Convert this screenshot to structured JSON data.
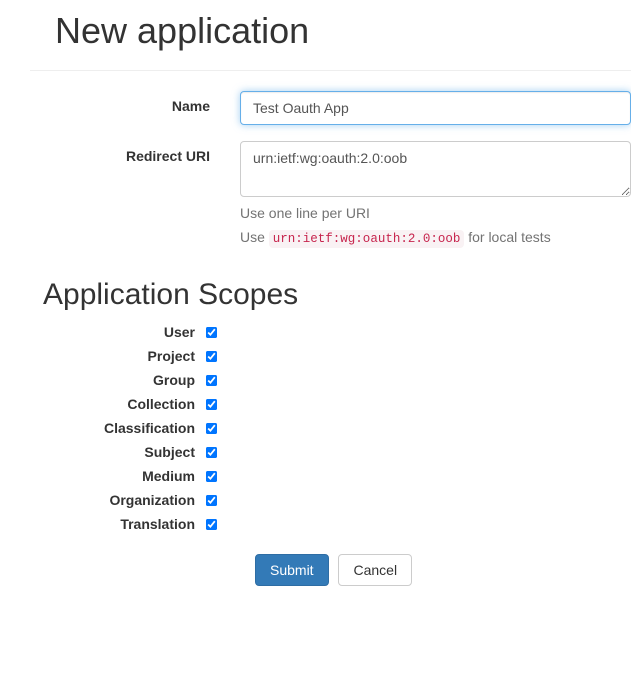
{
  "page_title": "New application",
  "form": {
    "name": {
      "label": "Name",
      "value": "Test Oauth App"
    },
    "redirect_uri": {
      "label": "Redirect URI",
      "value": "urn:ietf:wg:oauth:2.0:oob",
      "help1": "Use one line per URI",
      "help2_pre": "Use ",
      "help2_code": "urn:ietf:wg:oauth:2.0:oob",
      "help2_post": "  for local tests"
    }
  },
  "scopes": {
    "heading": "Application Scopes",
    "items": [
      {
        "label": "User",
        "checked": true
      },
      {
        "label": "Project",
        "checked": true
      },
      {
        "label": "Group",
        "checked": true
      },
      {
        "label": "Collection",
        "checked": true
      },
      {
        "label": "Classification",
        "checked": true
      },
      {
        "label": "Subject",
        "checked": true
      },
      {
        "label": "Medium",
        "checked": true
      },
      {
        "label": "Organization",
        "checked": true
      },
      {
        "label": "Translation",
        "checked": true
      }
    ]
  },
  "buttons": {
    "submit": "Submit",
    "cancel": "Cancel"
  }
}
